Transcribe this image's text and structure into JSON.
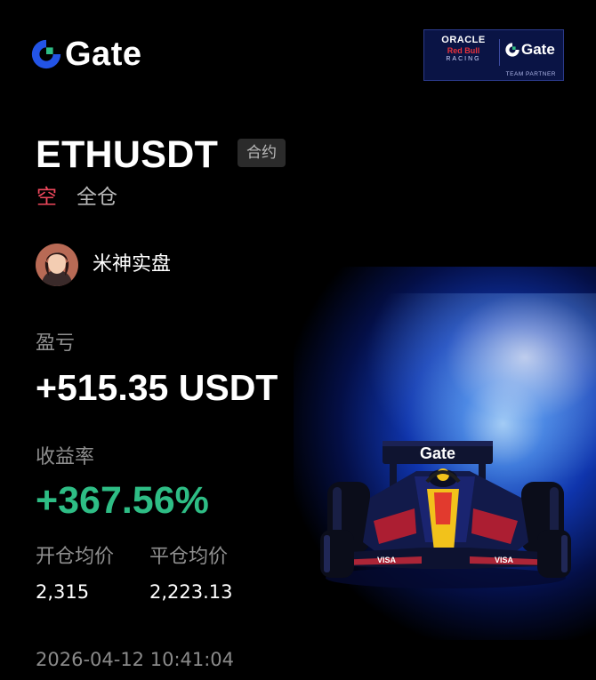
{
  "brand": {
    "logo_text": "Gate"
  },
  "sponsor": {
    "oracle": "ORACLE",
    "redbull": "Red Bull",
    "racing": "RACING",
    "gate": "Gate",
    "partner": "TEAM PARTNER"
  },
  "position": {
    "pair": "ETHUSDT",
    "contract_tag": "合约",
    "side": "空",
    "margin_mode": "全仓"
  },
  "user": {
    "name": "米神实盘"
  },
  "stats": {
    "pnl_label": "盈亏",
    "pnl_value": "+515.35 USDT",
    "roi_label": "收益率",
    "roi_value": "+367.56%",
    "open_price_label": "开仓均价",
    "open_price_value": "2,315",
    "close_price_label": "平仓均价",
    "close_price_value": "2,223.13"
  },
  "timestamp": "2026-04-12 10:41:04",
  "car": {
    "wing_text": "Gate",
    "nose_text": "VISA"
  },
  "colors": {
    "background": "#000000",
    "short_red": "#f0485d",
    "profit_green": "#2ebd85",
    "muted_gray": "#8f8f8f",
    "brand_blue": "#2354e6"
  },
  "icons": {
    "logo_mark": "gate-logo-icon",
    "avatar": "avatar-image"
  }
}
